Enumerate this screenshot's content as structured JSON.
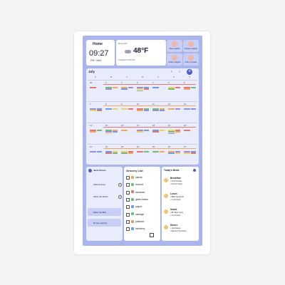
{
  "home": {
    "title": "Home",
    "time": "09:27",
    "date": "PM / Wed"
  },
  "weather": {
    "location": "New York",
    "temp": "48°F",
    "updated": "Updated at 5:06 PM",
    "range": "H: 50° L: 40°"
  },
  "profiles": [
    "Sara Hughes",
    "Teagan Hughes",
    "Jordan Hughes",
    "Kelly & Jordan"
  ],
  "calendar": {
    "month": "July",
    "days_of_week": [
      "S",
      "M",
      "T",
      "W",
      "T",
      "F",
      "S"
    ],
    "weeks": [
      [
        "30",
        "1",
        "2",
        "3",
        "4",
        "5",
        "6"
      ],
      [
        "7",
        "8",
        "9",
        "10",
        "11",
        "12",
        "13"
      ],
      [
        "14",
        "15",
        "16",
        "17",
        "18",
        "19",
        "20"
      ],
      [
        "21",
        "22",
        "23",
        "24",
        "25",
        "26",
        "27"
      ]
    ],
    "colors": {
      "red": "#e57373",
      "green": "#6fbf73",
      "orange": "#f3a65a",
      "purple": "#9c8ce0",
      "blue": "#6a9be8",
      "yellow": "#f0d060"
    }
  },
  "chores": {
    "title": "Jack Chores",
    "items": [
      "Walk the Dog",
      "Water the Plants",
      "Water the Bed",
      "Do the Laundry"
    ]
  },
  "grocery": {
    "title": "Grocery List",
    "items": [
      "carrots",
      "broccoli",
      "tomatoes",
      "green beans",
      "yogurt",
      "cabbage",
      "potatoes",
      "blueberry"
    ]
  },
  "meals": {
    "title": "Today's Meals",
    "sections": [
      {
        "name": "Breakfast",
        "items": [
          "Soft Pretzels",
          "French Toast"
        ]
      },
      {
        "name": "Lunch",
        "items": [
          "BBQ Spaghetti",
          "Cornbread"
        ]
      },
      {
        "name": "Snack",
        "items": [
          "BP Beef Jerky",
          "Cornbread"
        ]
      },
      {
        "name": "Dinner",
        "items": [
          "Jambalaya",
          "Banana Pancakes"
        ]
      }
    ]
  }
}
